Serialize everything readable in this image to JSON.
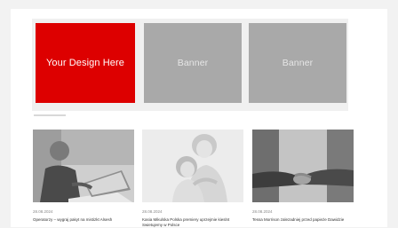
{
  "banners": [
    {
      "label": "Your Design Here",
      "color": "#dd0000"
    },
    {
      "label": "Banner",
      "color": "#a9a9a9"
    },
    {
      "label": "Banner",
      "color": "#a9a9a9"
    }
  ],
  "articles": [
    {
      "image": "business-person-laptop-photo",
      "date": "28.08.2024",
      "title": "Operatorzy – wygraj pakyt na mistizkt Alsesh"
    },
    {
      "image": "smiling-family-portrait-photo",
      "date": "28.08.2024",
      "title": "Kasia Mikulska Polska premiery uprzejmie kieslnt Swietujemy w Polsce"
    },
    {
      "image": "business-handshake-photo",
      "date": "28.08.2024",
      "title": "Tessa Morrison zalezadniej przed papieże Dawidzie"
    }
  ]
}
